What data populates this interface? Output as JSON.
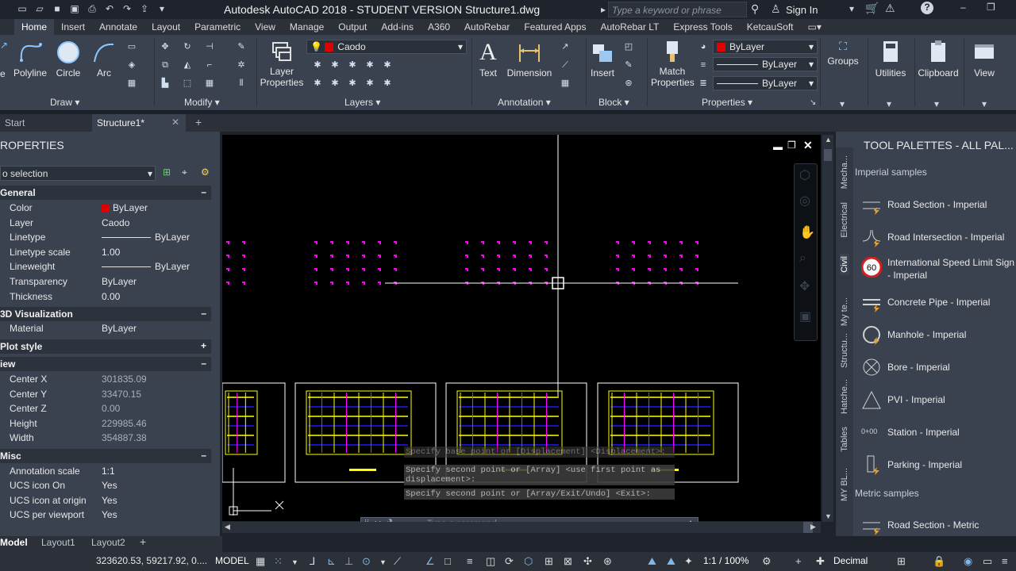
{
  "title": "Autodesk AutoCAD 2018 - STUDENT VERSION    Structure1.dwg",
  "search_placeholder": "Type a keyword or phrase",
  "signin": "Sign In",
  "ribbon_tabs": [
    "Home",
    "Insert",
    "Annotate",
    "Layout",
    "Parametric",
    "View",
    "Manage",
    "Output",
    "Add-ins",
    "A360",
    "AutoRebar",
    "Featured Apps",
    "AutoRebar LT",
    "Express Tools",
    "KetcauSoft"
  ],
  "ribbon": {
    "draw": {
      "polyline": "Polyline",
      "circle": "Circle",
      "arc": "Arc",
      "panel": "Draw"
    },
    "modify_panel": "Modify",
    "layers": {
      "layer_properties": "Layer Properties",
      "current_layer": "Caodo",
      "panel": "Layers"
    },
    "annotation": {
      "text": "Text",
      "dimension": "Dimension",
      "panel": "Annotation"
    },
    "block": {
      "insert": "Insert",
      "panel": "Block"
    },
    "properties": {
      "match": "Match Properties",
      "color": "ByLayer",
      "linetype": "ByLayer",
      "lineweight": "ByLayer",
      "panel": "Properties"
    },
    "groups": "Groups",
    "utilities": "Utilities",
    "clipboard": "Clipboard",
    "view": "View"
  },
  "doc_tabs": {
    "start": "Start",
    "current": "Structure1*"
  },
  "properties": {
    "title": "ROPERTIES",
    "selection": "o selection",
    "sections": {
      "general": "General",
      "viz": "3D Visualization",
      "plot": "Plot style",
      "view": "iew",
      "misc": "Misc"
    },
    "general": [
      {
        "k": "Color",
        "v": "ByLayer"
      },
      {
        "k": "Layer",
        "v": "Caodo"
      },
      {
        "k": "Linetype",
        "v": "ByLayer"
      },
      {
        "k": "Linetype scale",
        "v": "1.00"
      },
      {
        "k": "Lineweight",
        "v": "ByLayer"
      },
      {
        "k": "Transparency",
        "v": "ByLayer"
      },
      {
        "k": "Thickness",
        "v": "0.00"
      }
    ],
    "material": {
      "k": "Material",
      "v": "ByLayer"
    },
    "view": [
      {
        "k": "Center X",
        "v": "301835.09"
      },
      {
        "k": "Center Y",
        "v": "33470.15"
      },
      {
        "k": "Center Z",
        "v": "0.00"
      },
      {
        "k": "Height",
        "v": "229985.46"
      },
      {
        "k": "Width",
        "v": "354887.38"
      }
    ],
    "misc": [
      {
        "k": "Annotation scale",
        "v": "1:1"
      },
      {
        "k": "UCS icon On",
        "v": "Yes"
      },
      {
        "k": "UCS icon at origin",
        "v": "Yes"
      },
      {
        "k": "UCS per viewport",
        "v": "Yes"
      }
    ]
  },
  "command": {
    "history": [
      "Specify base point or [Displacement] <Displacement>:",
      "Specify second point or [Array] <use first point as\ndisplacement>:",
      "Specify second point or [Array/Exit/Undo] <Exit>:"
    ],
    "placeholder": "Type a command"
  },
  "layout_tabs": [
    "Model",
    "Layout1",
    "Layout2"
  ],
  "tool_palettes": {
    "title": "TOOL PALETTES - ALL PAL...",
    "side_tabs": [
      "Mecha...",
      "Electrical",
      "Civil",
      "My te...",
      "Structu...",
      "Hatche...",
      "Tables",
      "MY BL..."
    ],
    "imperial_header": "Imperial samples",
    "items": [
      "Road Section - Imperial",
      "Road Intersection - Imperial",
      "International Speed Limit Sign - Imperial",
      "Concrete Pipe - Imperial",
      "Manhole - Imperial",
      "Bore - Imperial",
      "PVI - Imperial",
      "Station - Imperial",
      "Parking - Imperial"
    ],
    "metric_header": "Metric samples",
    "metric_items": [
      "Road Section - Metric"
    ]
  },
  "status": {
    "coords": "323620.53, 59217.92, 0....",
    "model": "MODEL",
    "scale": "1:1 / 100%",
    "units": "Decimal"
  },
  "colors": {
    "accent": "#3a4250",
    "cad_magenta": "#ff00ff",
    "cad_yellow": "#ffff00",
    "cad_blue": "#1a1aff",
    "layer_color": "#e00000"
  }
}
